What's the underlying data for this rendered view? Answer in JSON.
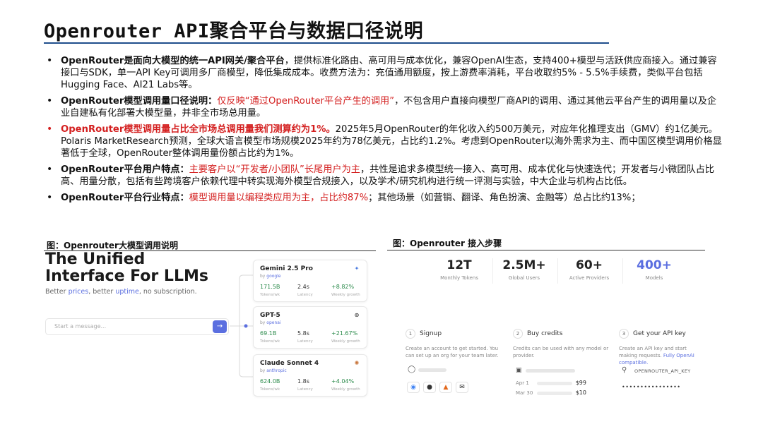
{
  "title": "Openrouter API聚合平台与数据口径说明",
  "bullets": [
    {
      "bold": "OpenRouter是面向大模型的统一API网关/聚合平台",
      "text": "，提供标准化路由、高可用与成本优化，兼容OpenAI生态，支持400+模型与活跃供应商接入。通过兼容接口与SDK，单一API Key可调用多厂商模型，降低集成成本。收费方法为：充值通用额度，按上游费率消耗，平台收取约5% - 5.5%手续费，类似平台包括Hugging Face、AI21 Labs等。"
    },
    {
      "bold": "OpenRouter模型调用量口径说明：",
      "red": "仅反映“通过OpenRouter平台产生的调用”",
      "text": "，不包含用户直接向模型厂商API的调用、通过其他云平台产生的调用量以及企业自建私有化部署大模型量，并非全市场总用量。"
    },
    {
      "red_bold": "OpenRouter模型调用量占比全市场总调用量我们测算约为1%。",
      "text": "2025年5月OpenRouter的年化收入约500万美元，对应年化推理支出（GMV）约1亿美元。Polaris MarketResearch预测，全球大语言模型市场规模2025年约为78亿美元，占比约1.2%。考虑到OpenRouter以海外需求为主、而中国区模型调用价格显著低于全球，OpenRouter整体调用量份额占比约为1%。"
    },
    {
      "bold": "OpenRouter平台用户特点：",
      "red": "主要客户以“开发者/小团队”长尾用户为主",
      "text": "，共性是追求多模型统一接入、高可用、成本优化与快速迭代；开发者与小微团队占比高、用量分散，包括有些跨境客户依赖代理中转实现海外模型合规接入，以及学术/研究机构进行统一评测与实验，中大企业与机构占比低。"
    },
    {
      "bold": "OpenRouter平台行业特点：",
      "red": "模型调用量以编程类应用为主，占比约87%",
      "text": "；其他场景（如营销、翻译、角色扮演、金融等）总占比约13%；"
    }
  ],
  "fig_left": {
    "caption": "图：Openrouter大模型调用说明",
    "hero_line1": "The Unified",
    "hero_line2": "Interface For LLMs",
    "sub_a": "Better ",
    "sub_b": "prices",
    "sub_c": ", better ",
    "sub_d": "uptime",
    "sub_e": ", no subscription.",
    "placeholder": "Start a message...",
    "send_icon": "→",
    "labels": {
      "tokens": "Tokens/wk",
      "latency": "Latency",
      "growth": "Weekly growth"
    },
    "models": [
      {
        "name": "Gemini 2.5 Pro",
        "by": "by",
        "provider": "google",
        "tokens": "171.5B",
        "latency": "2.4s",
        "growth": "+8.82%",
        "icon": "✦",
        "icon_color": "#4a7ae0"
      },
      {
        "name": "GPT-5",
        "by": "by",
        "provider": "openai",
        "tokens": "69.1B",
        "latency": "5.8s",
        "growth": "+21.67%",
        "icon": "⊛",
        "icon_color": "#222"
      },
      {
        "name": "Claude Sonnet 4",
        "by": "by",
        "provider": "anthropic",
        "tokens": "624.0B",
        "latency": "1.8s",
        "growth": "+4.04%",
        "icon": "✺",
        "icon_color": "#c8743a"
      }
    ]
  },
  "fig_right": {
    "caption": "图：Openrouter 接入步骤",
    "stats": [
      {
        "value": "12T",
        "label": "Monthly Tokens"
      },
      {
        "value": "2.5M+",
        "label": "Global Users"
      },
      {
        "value": "60+",
        "label": "Active Providers"
      },
      {
        "value": "400+",
        "label": "Models"
      }
    ],
    "steps": [
      {
        "num": "1",
        "title": "Signup",
        "desc": "Create an account to get started. You can set up an org for your team later.",
        "desc_link": ""
      },
      {
        "num": "2",
        "title": "Buy credits",
        "desc": "Credits can be used with any model or provider.",
        "desc_link": ""
      },
      {
        "num": "3",
        "title": "Get your API key",
        "desc": "Create an API key and start making requests. ",
        "desc_link": "Fully OpenAI compatible."
      }
    ],
    "credits": [
      {
        "date": "Apr 1",
        "amount": "$99"
      },
      {
        "date": "Mar 30",
        "amount": "$10"
      }
    ],
    "key_label": "OPENROUTER_API_KEY",
    "key_dots": "••••••••••••••••"
  }
}
